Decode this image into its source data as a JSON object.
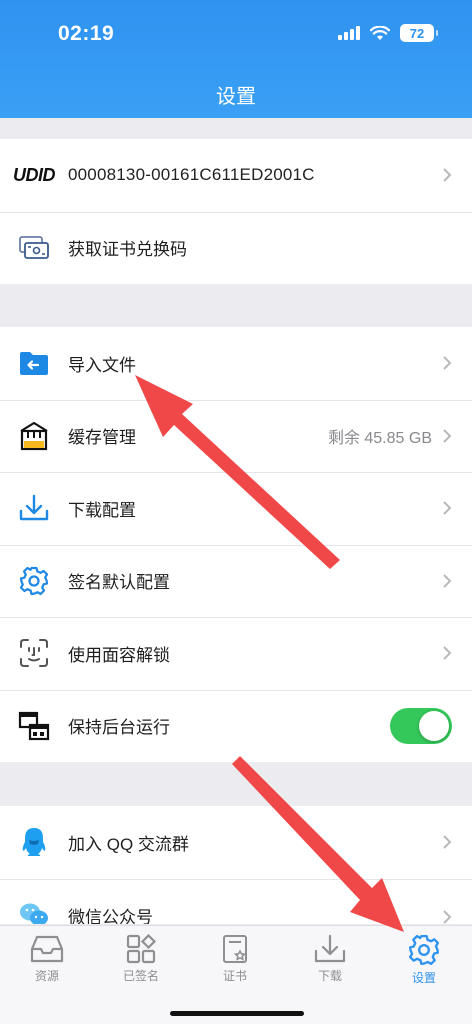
{
  "status_bar": {
    "time": "02:19",
    "battery": "72"
  },
  "header": {
    "title": "设置"
  },
  "group1": {
    "udid_label": "UDID",
    "udid_value": "00008130-00161C611ED2001C",
    "redeem_label": "获取证书兑换码"
  },
  "group2": {
    "import_label": "导入文件",
    "cache_label": "缓存管理",
    "cache_value": "剩余 45.85 GB",
    "download_label": "下载配置",
    "sign_default_label": "签名默认配置",
    "faceid_label": "使用面容解锁",
    "background_label": "保持后台运行",
    "background_enabled": true
  },
  "group3": {
    "qq_label": "加入 QQ 交流群",
    "wechat_label": "微信公众号"
  },
  "tabbar": {
    "tabs": [
      {
        "label": "资源",
        "icon": "inbox-tray-icon"
      },
      {
        "label": "已签名",
        "icon": "grid-apps-icon"
      },
      {
        "label": "证书",
        "icon": "certificate-icon"
      },
      {
        "label": "下载",
        "icon": "download-icon"
      },
      {
        "label": "设置",
        "icon": "gear-icon",
        "active": true
      }
    ]
  },
  "colors": {
    "accent": "#2f93f0",
    "toggle_on": "#34c759",
    "annotation_arrow": "#f24a4a"
  }
}
